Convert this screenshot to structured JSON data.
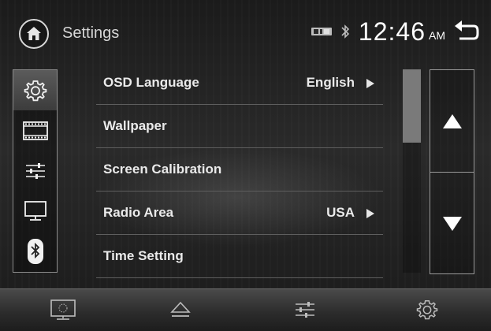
{
  "header": {
    "title": "Settings",
    "time": "12:46",
    "ampm": "AM"
  },
  "sidebar": {
    "tabs": [
      {
        "name": "settings",
        "icon": "gear-icon",
        "active": true
      },
      {
        "name": "video",
        "icon": "film-icon",
        "active": false
      },
      {
        "name": "audio",
        "icon": "equalizer-icon",
        "active": false
      },
      {
        "name": "display",
        "icon": "monitor-icon",
        "active": false
      },
      {
        "name": "bluetooth",
        "icon": "bluetooth-icon",
        "active": false
      }
    ]
  },
  "settings": {
    "rows": [
      {
        "label": "OSD Language",
        "value": "English"
      },
      {
        "label": "Wallpaper"
      },
      {
        "label": "Screen Calibration"
      },
      {
        "label": "Radio Area",
        "value": "USA"
      },
      {
        "label": "Time Setting"
      }
    ]
  },
  "scrollbar": {
    "position": 0.0,
    "visible_fraction": 0.36
  },
  "bottom_bar": {
    "buttons": [
      "screen-off-icon",
      "eject-icon",
      "equalizer-icon",
      "gear-icon"
    ]
  }
}
